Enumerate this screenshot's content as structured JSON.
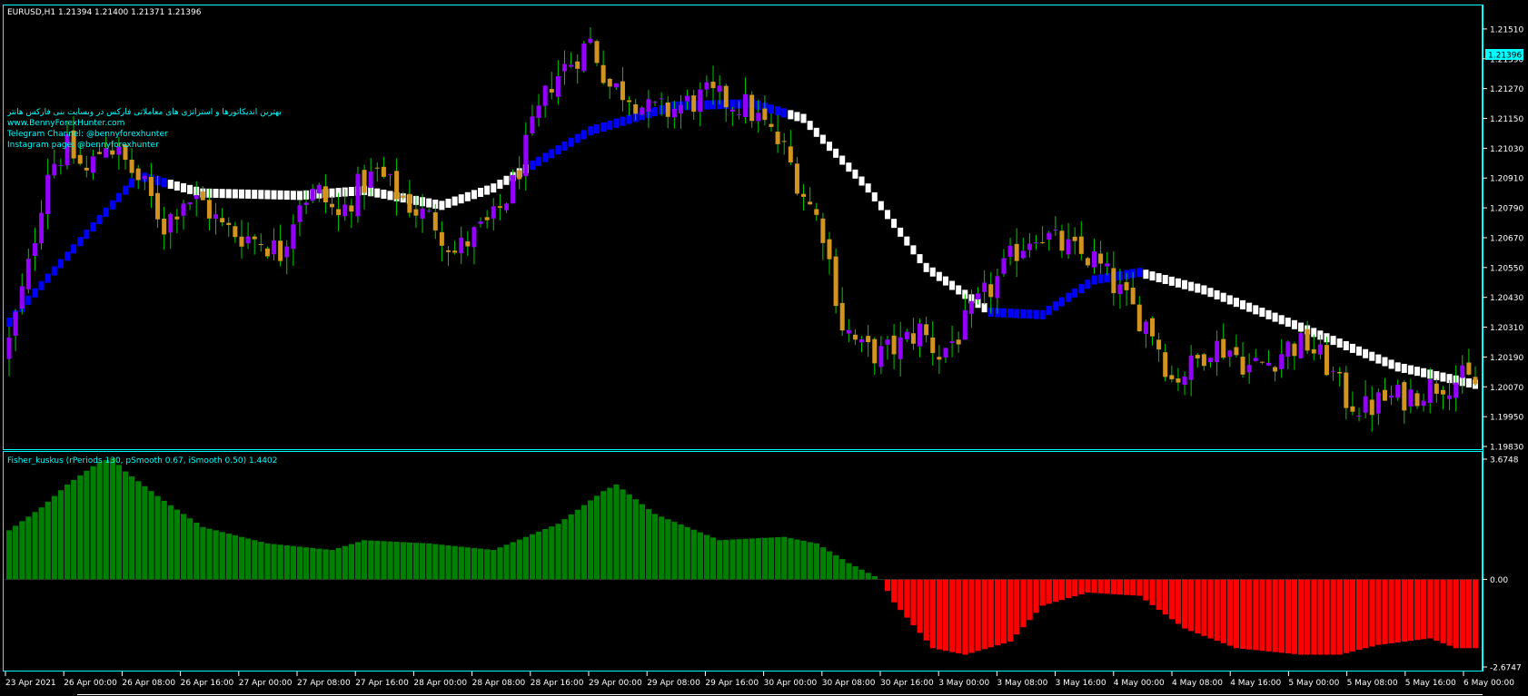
{
  "window": {
    "symbol_header": "EURUSD,H1  1.21394 1.21400 1.21371 1.21396",
    "watermark_lines": [
      "بهترین اندیکاتورها و استراتژی های معاملاتی فارکس در وبسایت بنی فارکس هانتر",
      "www.BennyForexHunter.com",
      "Telegram Channel: @bennyforexhunter",
      "Instagram page: @bennyforexhunter"
    ],
    "current_price_label": "1.21396"
  },
  "colors": {
    "background": "#000000",
    "frame": "#00ffff",
    "text": "#ffffff",
    "bull_body": "#9400ff",
    "bear_body": "#d2941e",
    "wick": "#00c800",
    "trend_up": "#0000ff",
    "trend_down": "#ffffff",
    "hist_pos": "#008000",
    "hist_neg": "#ff0000"
  },
  "indicator": {
    "header": "Fisher_kuskus  (rPeriods 130, pSmooth 0.67, iSmooth 0.50)   1.4402",
    "ticks": [
      "3.6748",
      "0.00",
      "-2.6747"
    ]
  },
  "chart_data": [
    {
      "type": "candlestick",
      "title": "EURUSD,H1",
      "ylim": [
        1.1983,
        1.2159
      ],
      "ytick_labels": [
        "1.21510",
        "1.21390",
        "1.21270",
        "1.21150",
        "1.21030",
        "1.20910",
        "1.20790",
        "1.20670",
        "1.20550",
        "1.20430",
        "1.20310",
        "1.20190",
        "1.20070",
        "1.19950",
        "1.19830"
      ],
      "x_labels": [
        "23 Apr 2021",
        "26 Apr 00:00",
        "26 Apr 08:00",
        "26 Apr 16:00",
        "27 Apr 00:00",
        "27 Apr 08:00",
        "27 Apr 16:00",
        "28 Apr 00:00",
        "28 Apr 08:00",
        "28 Apr 16:00",
        "29 Apr 00:00",
        "29 Apr 08:00",
        "29 Apr 16:00",
        "30 Apr 00:00",
        "30 Apr 08:00",
        "30 Apr 16:00",
        "3 May 00:00",
        "3 May 08:00",
        "3 May 16:00",
        "4 May 00:00",
        "4 May 08:00",
        "4 May 16:00",
        "5 May 00:00",
        "5 May 08:00",
        "5 May 16:00",
        "6 May 00:00"
      ],
      "close_anchors": [
        [
          0,
          1.2025
        ],
        [
          3,
          1.2055
        ],
        [
          6,
          1.2095
        ],
        [
          9,
          1.2103
        ],
        [
          12,
          1.2093
        ],
        [
          15,
          1.2106
        ],
        [
          18,
          1.2097
        ],
        [
          21,
          1.2087
        ],
        [
          24,
          1.2072
        ],
        [
          27,
          1.2083
        ],
        [
          30,
          1.2081
        ],
        [
          33,
          1.2071
        ],
        [
          36,
          1.2068
        ],
        [
          39,
          1.2066
        ],
        [
          42,
          1.2061
        ],
        [
          45,
          1.2083
        ],
        [
          48,
          1.2085
        ],
        [
          51,
          1.2075
        ],
        [
          54,
          1.2087
        ],
        [
          57,
          1.2093
        ],
        [
          60,
          1.2085
        ],
        [
          63,
          1.2078
        ],
        [
          66,
          1.2073
        ],
        [
          69,
          1.2061
        ],
        [
          72,
          1.2068
        ],
        [
          75,
          1.2074
        ],
        [
          78,
          1.2088
        ],
        [
          81,
          1.211
        ],
        [
          84,
          1.213
        ],
        [
          87,
          1.2138
        ],
        [
          90,
          1.2146
        ],
        [
          93,
          1.2128
        ],
        [
          96,
          1.2125
        ],
        [
          99,
          1.2118
        ],
        [
          102,
          1.2118
        ],
        [
          105,
          1.2121
        ],
        [
          108,
          1.2124
        ],
        [
          111,
          1.2122
        ],
        [
          114,
          1.212
        ],
        [
          117,
          1.2112
        ],
        [
          120,
          1.2102
        ],
        [
          123,
          1.2085
        ],
        [
          126,
          1.207
        ],
        [
          129,
          1.2032
        ],
        [
          132,
          1.2022
        ],
        [
          135,
          1.202
        ],
        [
          138,
          1.2024
        ],
        [
          141,
          1.203
        ],
        [
          144,
          1.202
        ],
        [
          147,
          1.2028
        ],
        [
          150,
          1.204
        ],
        [
          153,
          1.205
        ],
        [
          156,
          1.2062
        ],
        [
          159,
          1.207
        ],
        [
          162,
          1.2065
        ],
        [
          165,
          1.2061
        ],
        [
          168,
          1.2058
        ],
        [
          171,
          1.2048
        ],
        [
          174,
          1.2038
        ],
        [
          177,
          1.203
        ],
        [
          180,
          1.201
        ],
        [
          183,
          1.2015
        ],
        [
          186,
          1.2024
        ],
        [
          189,
          1.2022
        ],
        [
          192,
          1.2015
        ],
        [
          195,
          1.2017
        ],
        [
          198,
          1.2023
        ],
        [
          201,
          1.2024
        ],
        [
          204,
          1.2016
        ],
        [
          207,
          1.2002
        ],
        [
          210,
          1.1998
        ],
        [
          213,
          1.2002
        ],
        [
          216,
          1.2003
        ],
        [
          219,
          1.2006
        ],
        [
          222,
          1.2009
        ],
        [
          225,
          1.201
        ],
        [
          227,
          1.2008
        ]
      ],
      "trend_line": {
        "anchors": [
          [
            0,
            1.2033
          ],
          [
            20,
            1.2092
          ],
          [
            30,
            1.2085
          ],
          [
            45,
            1.2084
          ],
          [
            55,
            1.2086
          ],
          [
            67,
            1.208
          ],
          [
            75,
            1.2087
          ],
          [
            90,
            1.211
          ],
          [
            103,
            1.212
          ],
          [
            115,
            1.2121
          ],
          [
            123,
            1.2115
          ],
          [
            133,
            1.2087
          ],
          [
            142,
            1.2055
          ],
          [
            152,
            1.2037
          ],
          [
            160,
            1.2036
          ],
          [
            168,
            1.205
          ],
          [
            175,
            1.2053
          ],
          [
            185,
            1.2046
          ],
          [
            200,
            1.2031
          ],
          [
            215,
            1.2015
          ],
          [
            227,
            1.2008
          ]
        ],
        "up_segments": [
          [
            0,
            24
          ],
          [
            81,
            120
          ],
          [
            152,
            175
          ]
        ]
      }
    },
    {
      "type": "bar",
      "title": "Fisher_kuskus",
      "ylim": [
        -2.6747,
        3.6748
      ],
      "anchors": [
        [
          0,
          1.5
        ],
        [
          5,
          2.2
        ],
        [
          9,
          2.9
        ],
        [
          14,
          3.6
        ],
        [
          16,
          3.7
        ],
        [
          18,
          3.3
        ],
        [
          24,
          2.4
        ],
        [
          30,
          1.6
        ],
        [
          40,
          1.1
        ],
        [
          50,
          0.9
        ],
        [
          55,
          1.2
        ],
        [
          65,
          1.1
        ],
        [
          75,
          0.9
        ],
        [
          85,
          1.7
        ],
        [
          92,
          2.7
        ],
        [
          94,
          2.9
        ],
        [
          100,
          2.0
        ],
        [
          110,
          1.2
        ],
        [
          120,
          1.3
        ],
        [
          125,
          1.1
        ],
        [
          130,
          0.5
        ],
        [
          135,
          0.0
        ],
        [
          137,
          -0.7
        ],
        [
          143,
          -2.1
        ],
        [
          148,
          -2.3
        ],
        [
          155,
          -1.9
        ],
        [
          160,
          -0.8
        ],
        [
          167,
          -0.4
        ],
        [
          175,
          -0.5
        ],
        [
          182,
          -1.5
        ],
        [
          190,
          -2.1
        ],
        [
          200,
          -2.3
        ],
        [
          206,
          -2.3
        ],
        [
          212,
          -2.0
        ],
        [
          220,
          -1.8
        ],
        [
          224,
          -2.1
        ],
        [
          227,
          -2.1
        ]
      ],
      "bar_count": 228
    }
  ]
}
